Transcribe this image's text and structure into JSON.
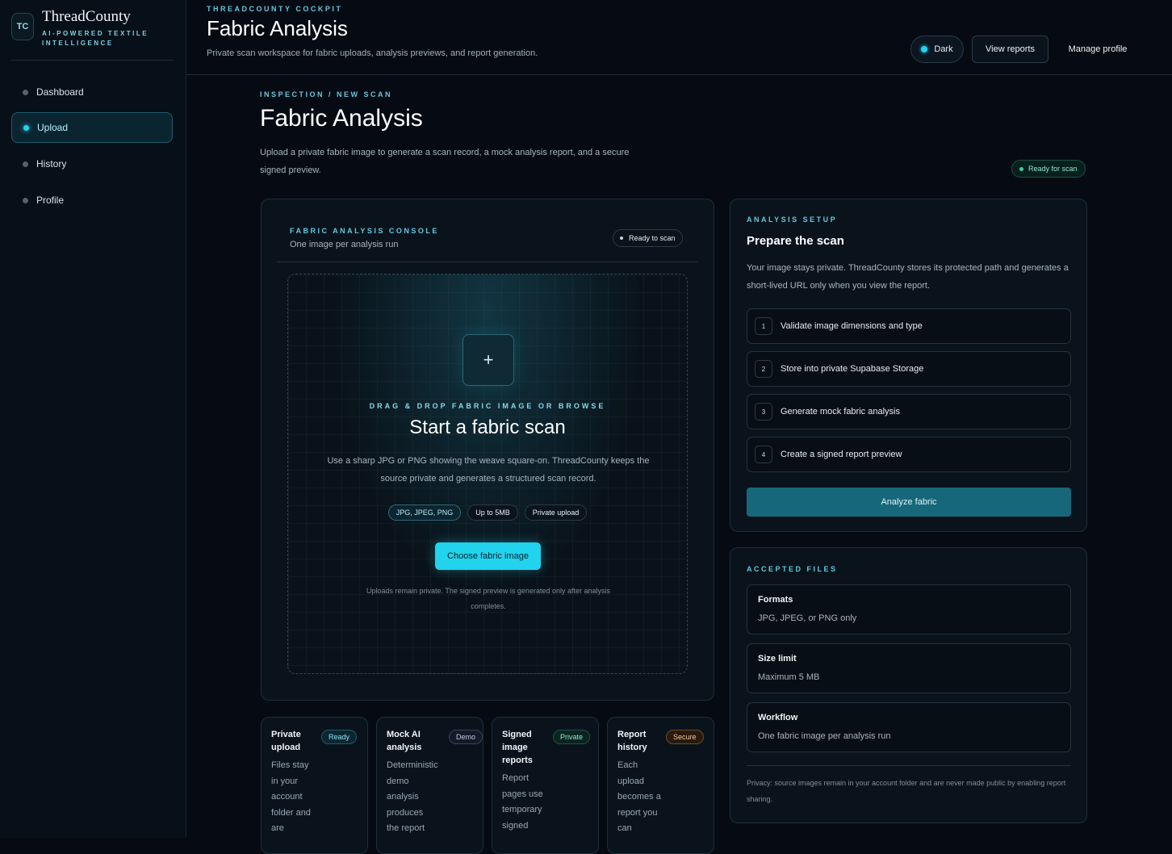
{
  "sidebar": {
    "logo": "TC",
    "brand_name": "ThreadCounty",
    "brand_sub": "AI-POWERED TEXTILE INTELLIGENCE",
    "items": [
      {
        "label": "Dashboard"
      },
      {
        "label": "Upload",
        "active": true
      },
      {
        "label": "History"
      },
      {
        "label": "Profile"
      }
    ]
  },
  "header": {
    "eyebrow": "THREADCOUNTY COCKPIT",
    "title": "Fabric Analysis",
    "subtitle": "Private scan workspace for fabric uploads, analysis previews, and report generation.",
    "theme_label": "Dark",
    "view_reports": "View reports",
    "manage_profile": "Manage profile"
  },
  "main": {
    "breadcrumb": "INSPECTION / NEW SCAN",
    "title": "Fabric Analysis",
    "description": "Upload a private fabric image to generate a scan record, a mock analysis report, and a secure signed preview.",
    "status": "Ready for scan"
  },
  "console": {
    "eyebrow": "FABRIC ANALYSIS CONSOLE",
    "subtitle": "One image per analysis run",
    "status": "Ready to scan",
    "dropzone": {
      "icon": "plus-icon",
      "plus": "+",
      "eyebrow": "DRAG & DROP FABRIC IMAGE OR BROWSE",
      "title": "Start a fabric scan",
      "description": "Use a sharp JPG or PNG showing the weave square-on. ThreadCounty keeps the source private and generates a structured scan record.",
      "chips": [
        "JPG, JPEG, PNG",
        "Up to 5MB",
        "Private upload"
      ],
      "button": "Choose fabric image",
      "note": "Uploads remain private. The signed preview is generated only after analysis completes."
    }
  },
  "features": [
    {
      "title": "Private upload",
      "badge": "Ready",
      "desc": "Files stay in your account folder and are"
    },
    {
      "title": "Mock AI analysis",
      "badge": "Demo",
      "desc": "Deterministic demo analysis produces the report"
    },
    {
      "title": "Signed image reports",
      "badge": "Private",
      "desc": "Report pages use temporary signed"
    },
    {
      "title": "Report history",
      "badge": "Secure",
      "desc": "Each upload becomes a report you can"
    }
  ],
  "setup": {
    "eyebrow": "ANALYSIS SETUP",
    "title": "Prepare the scan",
    "description": "Your image stays private. ThreadCounty stores its protected path and generates a short-lived URL only when you view the report.",
    "steps": [
      {
        "num": "1",
        "label": "Validate image dimensions and type"
      },
      {
        "num": "2",
        "label": "Store into private Supabase Storage"
      },
      {
        "num": "3",
        "label": "Generate mock fabric analysis"
      },
      {
        "num": "4",
        "label": "Create a signed report preview"
      }
    ],
    "button": "Analyze fabric"
  },
  "accepted": {
    "eyebrow": "ACCEPTED FILES",
    "items": [
      {
        "title": "Formats",
        "value": "JPG, JPEG, or PNG only"
      },
      {
        "title": "Size limit",
        "value": "Maximum 5 MB"
      },
      {
        "title": "Workflow",
        "value": "One fabric image per analysis run"
      }
    ],
    "note": "Privacy: source images remain in your account folder and are never made public by enabling report sharing."
  },
  "colors": {
    "accent": "#22d3ee",
    "background": "#060b13",
    "primary_button": "#17677a"
  }
}
